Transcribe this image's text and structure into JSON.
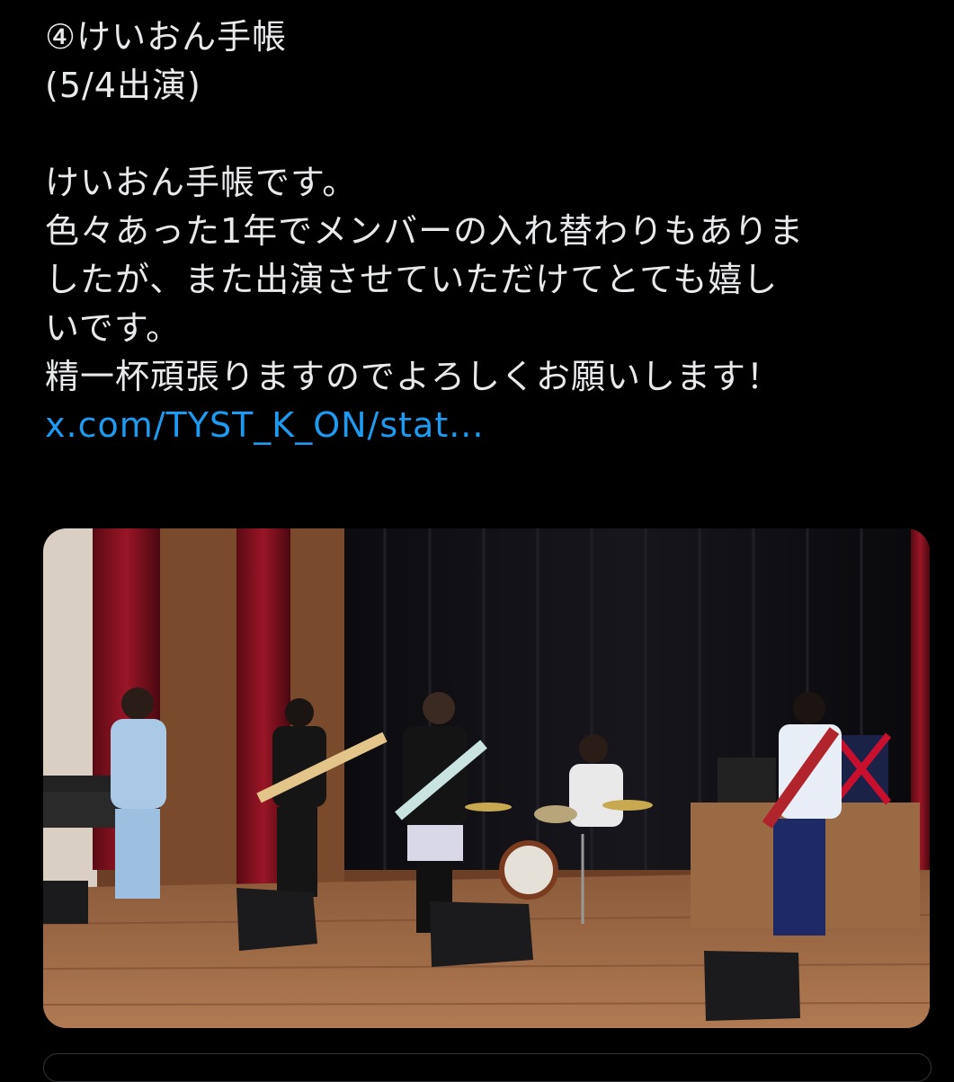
{
  "tweet": {
    "lines": [
      "④けいおん手帳",
      "(5/4出演)",
      "",
      "けいおん手帳です。",
      "色々あった1年でメンバーの入れ替わりもありま",
      "したが、また出演させていただけてとても嬉し",
      "いです。",
      "精一杯頑張りますのでよろしくお願いします！"
    ],
    "link_text": "x.com/TYST_K_ON/stat...",
    "media_alt": "photo of a band performing on a wooden stage"
  },
  "colors": {
    "background": "#000000",
    "text": "#e7e9ea",
    "link": "#1d9bf0"
  }
}
